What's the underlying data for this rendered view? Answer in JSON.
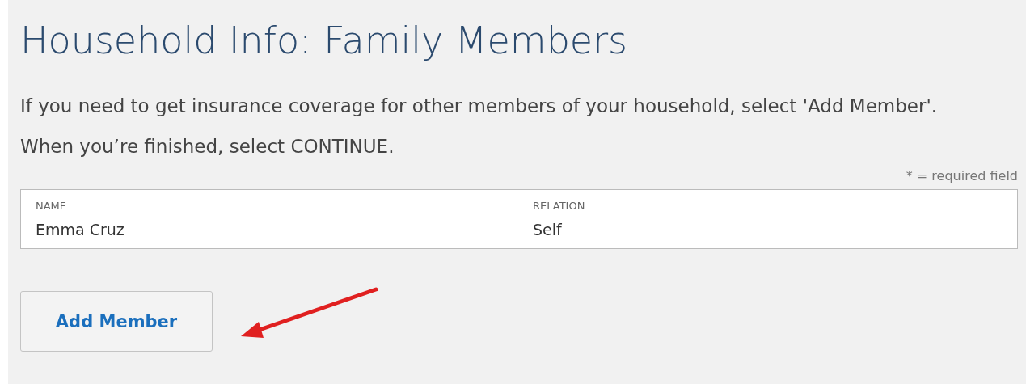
{
  "title": "Household Info: Family Members",
  "intro": "If you need to get insurance coverage for other members of your household, select 'Add Member'. When you’re finished, select CONTINUE.",
  "required_note": "* = required field",
  "members": {
    "columns": [
      "NAME",
      "RELATION"
    ],
    "rows": [
      [
        "Emma Cruz",
        "Self"
      ]
    ]
  },
  "add_button": "Add Member"
}
